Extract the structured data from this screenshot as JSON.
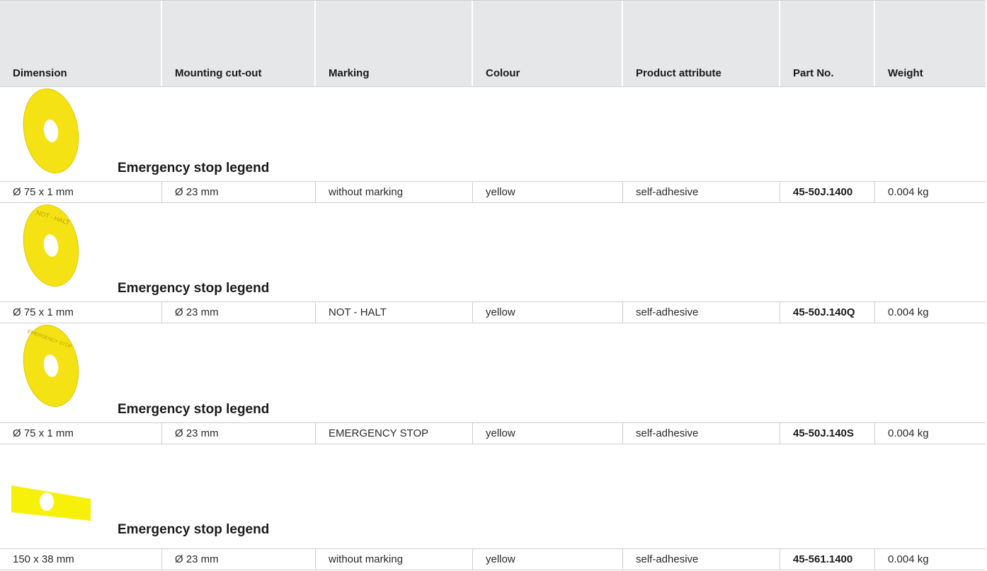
{
  "colors": {
    "header_bg": "#e6e7e8",
    "grid_line": "#cfcfcf",
    "legend_yellow": "#f5e214"
  },
  "header": {
    "columns": [
      "Dimension",
      "Mounting cut-out",
      "Marking",
      "Colour",
      "Product attribute",
      "Part No.",
      "Weight"
    ]
  },
  "products": [
    {
      "title": "Emergency stop legend",
      "image": "round-yellow-legend-plain",
      "imprint": "",
      "row": [
        "Ø 75 x 1 mm",
        "Ø 23 mm",
        "without marking",
        "yellow",
        "self-adhesive",
        "45-50J.1400",
        "0.004 kg"
      ]
    },
    {
      "title": "Emergency stop legend",
      "image": "round-yellow-legend-not-halt",
      "imprint": "NOT - HALT",
      "row": [
        "Ø 75 x 1 mm",
        "Ø 23 mm",
        "NOT - HALT",
        "yellow",
        "self-adhesive",
        "45-50J.140Q",
        "0.004 kg"
      ]
    },
    {
      "title": "Emergency stop legend",
      "image": "round-yellow-legend-emergency-stop",
      "imprint": "EMERGENCY STOP",
      "row": [
        "Ø 75 x 1 mm",
        "Ø 23 mm",
        "EMERGENCY STOP",
        "yellow",
        "self-adhesive",
        "45-50J.140S",
        "0.004 kg"
      ]
    },
    {
      "title": "Emergency stop legend",
      "image": "rectangular-yellow-legend-plain",
      "imprint": "",
      "row": [
        "150 x 38 mm",
        "Ø 23 mm",
        "without marking",
        "yellow",
        "self-adhesive",
        "45-561.1400",
        "0.004 kg"
      ]
    }
  ]
}
